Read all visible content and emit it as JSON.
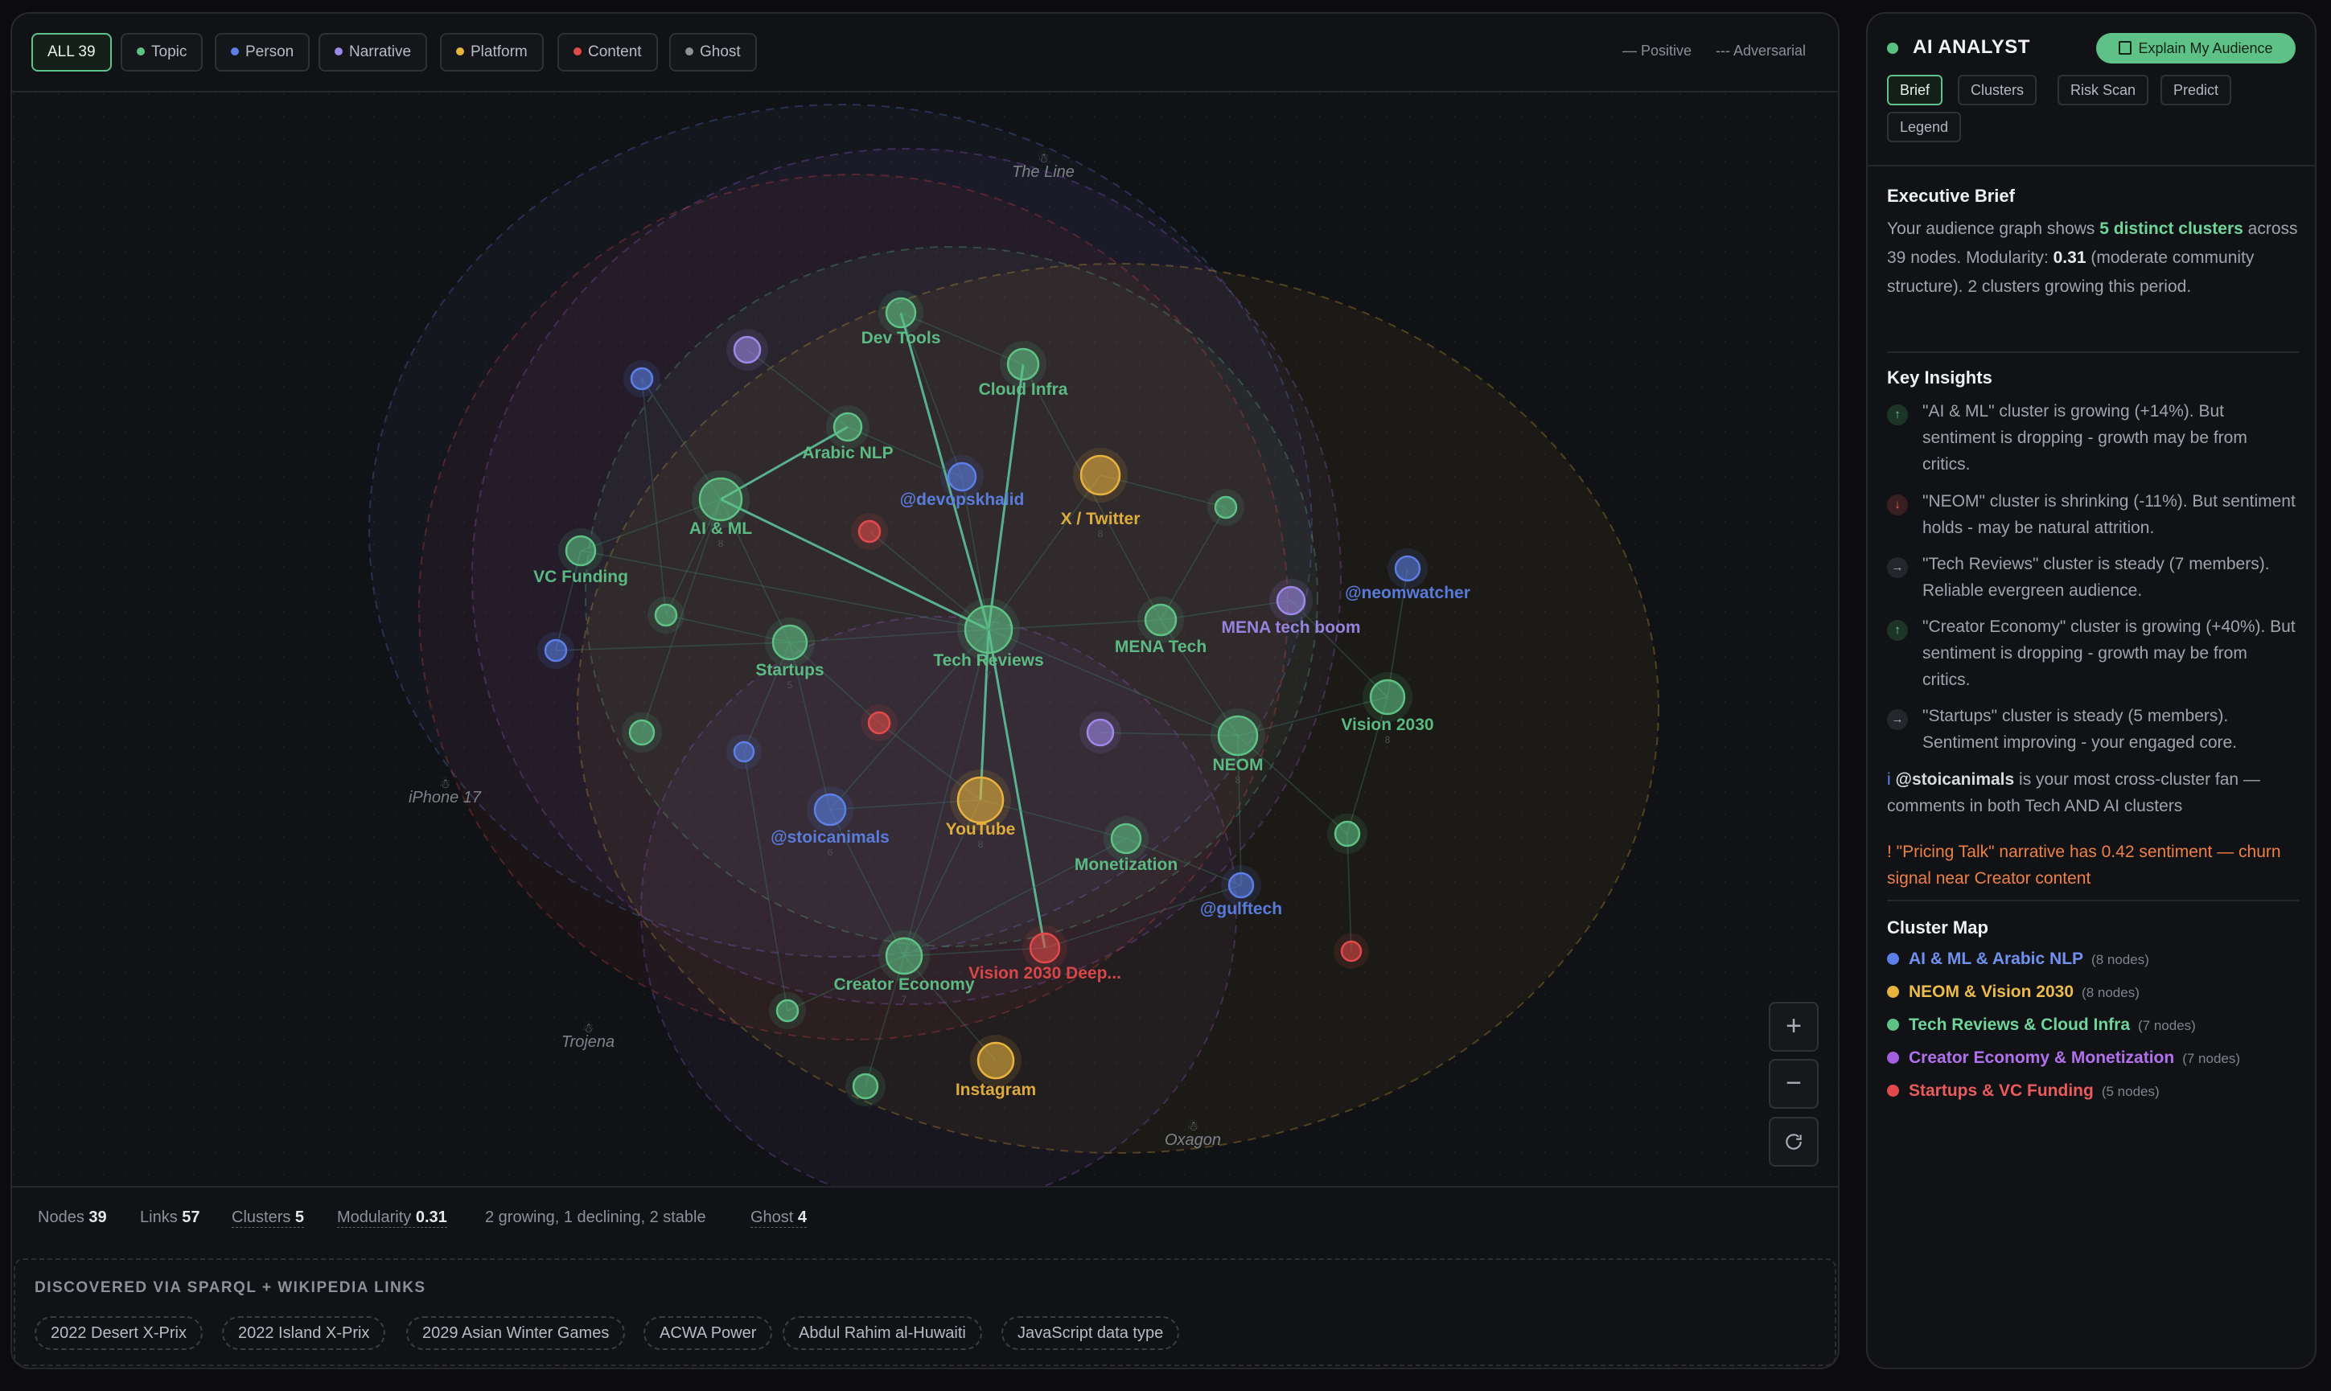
{
  "filters": [
    {
      "label": "ALL 39",
      "color": null,
      "active": true
    },
    {
      "label": "Topic",
      "color": "#5ec287",
      "active": false
    },
    {
      "label": "Person",
      "color": "#5b7fe6",
      "active": false
    },
    {
      "label": "Narrative",
      "color": "#9c88e8",
      "active": false
    },
    {
      "label": "Platform",
      "color": "#e8b23e",
      "active": false
    },
    {
      "label": "Content",
      "color": "#e14a4a",
      "active": false
    },
    {
      "label": "Ghost",
      "color": "#8c9097",
      "active": false
    }
  ],
  "edge_legend": {
    "positive": "— Positive",
    "adversarial": "--- Adversarial"
  },
  "colors": {
    "topic": "#5ec287",
    "person": "#5b7fe6",
    "narrative": "#9c88e8",
    "platform": "#e8b23e",
    "content": "#e14a4a",
    "ghost": "#8c9097"
  },
  "graph": {
    "nodes": [
      {
        "id": "ai_ml",
        "label": "AI & ML",
        "type": "topic",
        "badge": "8"
      },
      {
        "id": "dev_tools",
        "label": "Dev Tools",
        "type": "topic"
      },
      {
        "id": "cloud_infra",
        "label": "Cloud Infra",
        "type": "topic"
      },
      {
        "id": "arabic_nlp",
        "label": "Arabic NLP",
        "type": "topic"
      },
      {
        "id": "vc_funding",
        "label": "VC Funding",
        "type": "topic"
      },
      {
        "id": "startups",
        "label": "Startups",
        "type": "topic",
        "badge": "5"
      },
      {
        "id": "tech_reviews",
        "label": "Tech Reviews",
        "type": "topic",
        "badge": "7"
      },
      {
        "id": "mena_tech",
        "label": "MENA Tech",
        "type": "topic"
      },
      {
        "id": "neom",
        "label": "NEOM",
        "type": "topic",
        "badge": "8"
      },
      {
        "id": "vision_2030",
        "label": "Vision 2030",
        "type": "topic",
        "badge": "8"
      },
      {
        "id": "monetization",
        "label": "Monetization",
        "type": "topic"
      },
      {
        "id": "creator_economy",
        "label": "Creator Economy",
        "type": "topic",
        "badge": "7"
      },
      {
        "id": "devopskhalid",
        "label": "@devopskhalid",
        "type": "person"
      },
      {
        "id": "neomwatcher",
        "label": "@neomwatcher",
        "type": "person"
      },
      {
        "id": "stoicanimals",
        "label": "@stoicanimals",
        "type": "person",
        "badge": "6"
      },
      {
        "id": "gulftech",
        "label": "@gulftech",
        "type": "person"
      },
      {
        "id": "mena_boom",
        "label": "MENA tech boom",
        "type": "narrative"
      },
      {
        "id": "x_twitter",
        "label": "X / Twitter",
        "type": "platform",
        "badge": "8"
      },
      {
        "id": "youtube",
        "label": "YouTube",
        "type": "platform",
        "badge": "8"
      },
      {
        "id": "instagram",
        "label": "Instagram",
        "type": "platform"
      },
      {
        "id": "vision_deep",
        "label": "Vision 2030 Deep...",
        "type": "content"
      },
      {
        "id": "u1",
        "label": "",
        "type": "narrative"
      },
      {
        "id": "u2",
        "label": "",
        "type": "person"
      },
      {
        "id": "u3",
        "label": "",
        "type": "content"
      },
      {
        "id": "u4",
        "label": "",
        "type": "topic"
      },
      {
        "id": "u5",
        "label": "",
        "type": "topic"
      },
      {
        "id": "u6",
        "label": "",
        "type": "person"
      },
      {
        "id": "u7",
        "label": "",
        "type": "topic"
      },
      {
        "id": "u8",
        "label": "",
        "type": "person"
      },
      {
        "id": "u9",
        "label": "",
        "type": "content"
      },
      {
        "id": "u10",
        "label": "",
        "type": "narrative"
      },
      {
        "id": "u11",
        "label": "",
        "type": "topic"
      },
      {
        "id": "u12",
        "label": "",
        "type": "content"
      },
      {
        "id": "u13",
        "label": "",
        "type": "topic"
      },
      {
        "id": "u14",
        "label": "",
        "type": "topic"
      }
    ],
    "ghosts": [
      "The Line",
      "iPhone 17",
      "Trojena",
      "Oxagon"
    ],
    "edges": [
      [
        "tech_reviews",
        "dev_tools"
      ],
      [
        "tech_reviews",
        "cloud_infra"
      ],
      [
        "tech_reviews",
        "ai_ml"
      ],
      [
        "tech_reviews",
        "youtube"
      ],
      [
        "tech_reviews",
        "vision_deep"
      ],
      [
        "tech_reviews",
        "neom"
      ],
      [
        "tech_reviews",
        "u3"
      ],
      [
        "tech_reviews",
        "devopskhalid"
      ],
      [
        "tech_reviews",
        "startups"
      ],
      [
        "tech_reviews",
        "mena_tech"
      ],
      [
        "tech_reviews",
        "stoicanimals"
      ],
      [
        "tech_reviews",
        "creator_economy"
      ],
      [
        "tech_reviews",
        "x_twitter"
      ],
      [
        "tech_reviews",
        "vc_funding"
      ],
      [
        "ai_ml",
        "arabic_nlp"
      ],
      [
        "ai_ml",
        "startups"
      ],
      [
        "ai_ml",
        "u5"
      ],
      [
        "ai_ml",
        "u7"
      ],
      [
        "ai_ml",
        "vc_funding"
      ],
      [
        "ai_ml",
        "u2"
      ],
      [
        "dev_tools",
        "cloud_infra"
      ],
      [
        "arabic_nlp",
        "devopskhalid"
      ],
      [
        "arabic_nlp",
        "u1"
      ],
      [
        "neom",
        "vision_2030"
      ],
      [
        "neom",
        "gulftech"
      ],
      [
        "neom",
        "mena_tech"
      ],
      [
        "neom",
        "u11"
      ],
      [
        "neom",
        "u10"
      ],
      [
        "vision_2030",
        "neomwatcher"
      ],
      [
        "vision_2030",
        "u11"
      ],
      [
        "vision_2030",
        "mena_boom"
      ],
      [
        "u11",
        "u12"
      ],
      [
        "creator_economy",
        "monetization"
      ],
      [
        "creator_economy",
        "youtube"
      ],
      [
        "creator_economy",
        "instagram"
      ],
      [
        "creator_economy",
        "u13"
      ],
      [
        "creator_economy",
        "u14"
      ],
      [
        "creator_economy",
        "stoicanimals"
      ],
      [
        "youtube",
        "monetization"
      ],
      [
        "youtube",
        "stoicanimals"
      ],
      [
        "startups",
        "u8"
      ],
      [
        "startups",
        "u9"
      ],
      [
        "startups",
        "stoicanimals"
      ],
      [
        "vc_funding",
        "u6"
      ],
      [
        "mena_tech",
        "u4"
      ],
      [
        "x_twitter",
        "u4"
      ],
      [
        "cloud_infra",
        "mena_tech"
      ],
      [
        "u8",
        "u13"
      ],
      [
        "u6",
        "startups"
      ],
      [
        "monetization",
        "gulftech"
      ],
      [
        "mena_tech",
        "mena_boom"
      ],
      [
        "vision_deep",
        "gulftech"
      ],
      [
        "creator_economy",
        "vision_deep"
      ],
      [
        "u9",
        "youtube"
      ],
      [
        "startups",
        "u5"
      ],
      [
        "u2",
        "u5"
      ],
      [
        "dev_tools",
        "devopskhalid"
      ]
    ],
    "strong_edges": [
      [
        "tech_reviews",
        "dev_tools"
      ],
      [
        "tech_reviews",
        "cloud_infra"
      ],
      [
        "tech_reviews",
        "ai_ml"
      ],
      [
        "tech_reviews",
        "youtube"
      ],
      [
        "tech_reviews",
        "vision_deep"
      ],
      [
        "ai_ml",
        "arabic_nlp"
      ]
    ]
  },
  "stats": [
    {
      "label": "Nodes",
      "value": "39",
      "underline": false
    },
    {
      "label": "Links",
      "value": "57",
      "underline": false
    },
    {
      "label": "Clusters",
      "value": "5",
      "underline": true
    },
    {
      "label": "Modularity",
      "value": "0.31",
      "underline": true
    },
    {
      "label": "2 growing, 1 declining, 2 stable",
      "value": "",
      "underline": false
    },
    {
      "label": "Ghost",
      "value": "4",
      "underline": true
    }
  ],
  "discovered": {
    "title": "DISCOVERED VIA SPARQL + WIKIPEDIA LINKS",
    "items": [
      "2022 Desert X-Prix",
      "2022 Island X-Prix",
      "2029 Asian Winter Games",
      "ACWA Power",
      "Abdul Rahim al-Huwaiti",
      "JavaScript data type"
    ]
  },
  "analyst": {
    "title": "AI ANALYST",
    "explain_button": "Explain My Audience",
    "tabs": [
      "Brief",
      "Clusters",
      "Risk Scan",
      "Predict",
      "Legend"
    ],
    "active_tab": "Brief",
    "brief_title": "Executive Brief",
    "brief": {
      "t1": "Your audience graph shows ",
      "clusters": "5 distinct clusters",
      "t2": " across 39 nodes. Modularity: ",
      "modularity": "0.31",
      "t3": " (moderate community structure). 2 clusters growing this period."
    },
    "insights_title": "Key Insights",
    "insights": [
      {
        "trend": "up",
        "text": "\"AI & ML\" cluster is growing (+14%). But sentiment is dropping - growth may be from critics."
      },
      {
        "trend": "down",
        "text": "\"NEOM\" cluster is shrinking (-11%). But sentiment holds - may be natural attrition."
      },
      {
        "trend": "flat",
        "text": "\"Tech Reviews\" cluster is steady (7 members). Reliable evergreen audience."
      },
      {
        "trend": "up",
        "text": "\"Creator Economy\" cluster is growing (+40%). But sentiment is dropping - growth may be from critics."
      },
      {
        "trend": "flat",
        "text": "\"Startups\" cluster is steady (5 members). Sentiment improving - your engaged core."
      }
    ],
    "fan_note": {
      "prefix": "i ",
      "handle": "@stoicanimals",
      "rest": " is your most cross-cluster fan — comments in both Tech AND AI clusters"
    },
    "risk_note": "! \"Pricing Talk\" narrative has 0.42 sentiment — churn signal near Creator content",
    "cluster_map_title": "Cluster Map",
    "clusters": [
      {
        "name": "AI & ML & Arabic NLP",
        "count": "(8 nodes)",
        "color": "#5b7fe6"
      },
      {
        "name": "NEOM & Vision 2030",
        "count": "(8 nodes)",
        "color": "#e8b23e"
      },
      {
        "name": "Tech Reviews & Cloud Infra",
        "count": "(7 nodes)",
        "color": "#5ec287"
      },
      {
        "name": "Creator Economy & Monetization",
        "count": "(7 nodes)",
        "color": "#a35fe0"
      },
      {
        "name": "Startups & VC Funding",
        "count": "(5 nodes)",
        "color": "#e14a4a"
      }
    ]
  }
}
